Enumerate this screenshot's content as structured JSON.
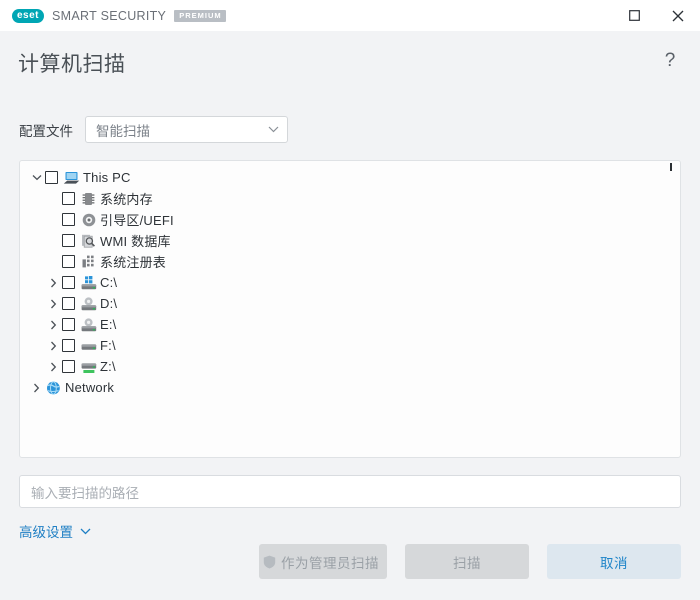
{
  "window": {
    "brand_logo_text": "eset",
    "brand_name": "SMART SECURITY",
    "brand_edition": "PREMIUM",
    "maximize_icon": "maximize-icon",
    "close_icon": "close-icon"
  },
  "header": {
    "title": "计算机扫描",
    "help_label": "?"
  },
  "profile": {
    "label": "配置文件",
    "selected": "智能扫描",
    "options": [
      "智能扫描"
    ],
    "chevron_icon": "chevron-down-icon"
  },
  "tree": {
    "nodes": [
      {
        "label": "This PC",
        "icon": "computer-icon",
        "indent": 0,
        "arrow": "down",
        "checkbox": true,
        "checked": false
      },
      {
        "label": "系统内存",
        "icon": "memory-icon",
        "indent": 1,
        "arrow": "none",
        "checkbox": true,
        "checked": false
      },
      {
        "label": "引导区/UEFI",
        "icon": "disc-icon",
        "indent": 1,
        "arrow": "none",
        "checkbox": true,
        "checked": false
      },
      {
        "label": "WMI 数据库",
        "icon": "wmi-database-icon",
        "indent": 1,
        "arrow": "none",
        "checkbox": true,
        "checked": false
      },
      {
        "label": "系统注册表",
        "icon": "registry-icon",
        "indent": 1,
        "arrow": "none",
        "checkbox": true,
        "checked": false
      },
      {
        "label": "C:\\",
        "icon": "windows-drive-icon",
        "indent": 1,
        "arrow": "right",
        "checkbox": true,
        "checked": false
      },
      {
        "label": "D:\\",
        "icon": "optical-drive-icon",
        "indent": 1,
        "arrow": "right",
        "checkbox": true,
        "checked": false
      },
      {
        "label": "E:\\",
        "icon": "optical-drive-icon",
        "indent": 1,
        "arrow": "right",
        "checkbox": true,
        "checked": false
      },
      {
        "label": "F:\\",
        "icon": "hard-drive-icon",
        "indent": 1,
        "arrow": "right",
        "checkbox": true,
        "checked": false
      },
      {
        "label": "Z:\\",
        "icon": "network-drive-icon",
        "indent": 1,
        "arrow": "right",
        "checkbox": true,
        "checked": false
      },
      {
        "label": "Network",
        "icon": "globe-icon",
        "indent": 0,
        "arrow": "right",
        "checkbox": false,
        "checked": false
      }
    ]
  },
  "path_field": {
    "placeholder": "输入要扫描的路径",
    "value": ""
  },
  "advanced": {
    "label": "高级设置",
    "chevron_icon": "chevron-down-icon"
  },
  "buttons": {
    "scan_as_admin": "作为管理员扫描",
    "scan_as_admin_icon": "shield-icon",
    "scan": "扫描",
    "cancel": "取消"
  },
  "colors": {
    "brand_teal": "#00a6b4",
    "accent_blue": "#1f85c9",
    "link_blue": "#1f7fc4",
    "cancel_bg": "#dde7ef",
    "body_bg": "#f2f3f5",
    "disabled_btn_bg": "#d6d8da",
    "disabled_btn_text": "#9aa0a6"
  }
}
